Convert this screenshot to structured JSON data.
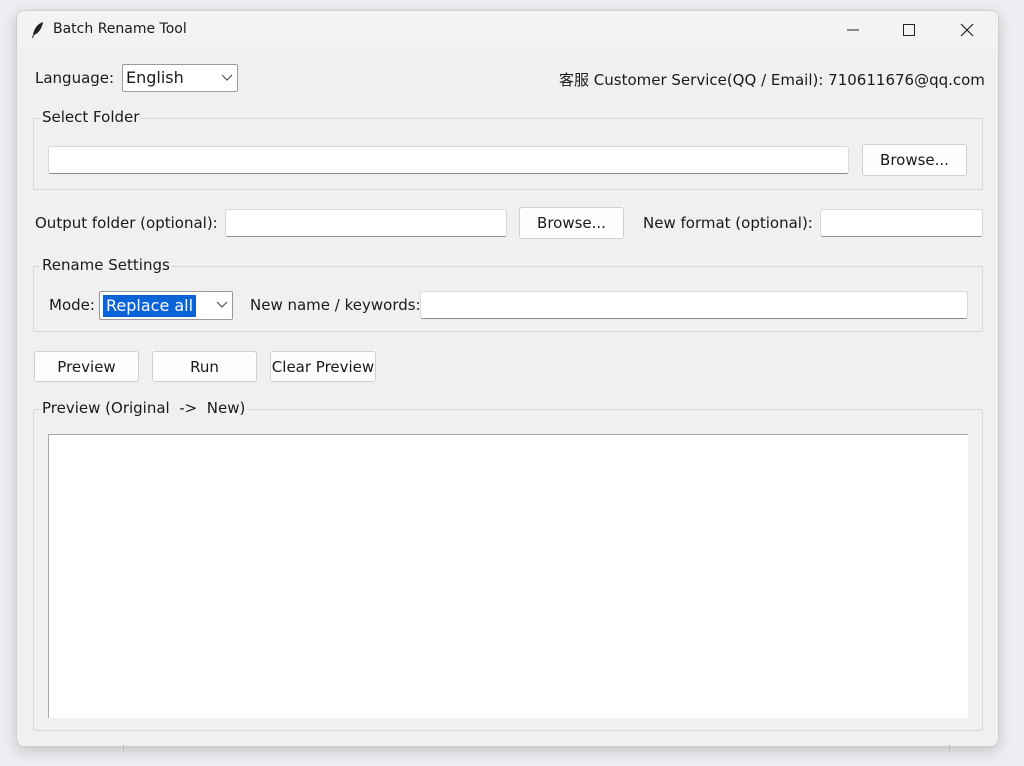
{
  "window": {
    "title": "Batch Rename Tool"
  },
  "header": {
    "language_label": "Language:",
    "language_value": "English",
    "support_text": "客服 Customer Service(QQ / Email): 710611676@qq.com"
  },
  "select_folder": {
    "group_title": "Select Folder",
    "path_value": "",
    "browse_label": "Browse..."
  },
  "output": {
    "output_label": "Output folder (optional):",
    "output_value": "",
    "browse_label": "Browse...",
    "format_label": "New format (optional):",
    "format_value": ""
  },
  "rename_settings": {
    "group_title": "Rename Settings",
    "mode_label": "Mode:",
    "mode_value": "Replace all",
    "keywords_label": "New name / keywords:",
    "keywords_value": ""
  },
  "actions": {
    "preview_label": "Preview",
    "run_label": "Run",
    "clear_label": "Clear Preview"
  },
  "preview": {
    "group_title": "Preview (Original  ->  New)",
    "content": ""
  }
}
